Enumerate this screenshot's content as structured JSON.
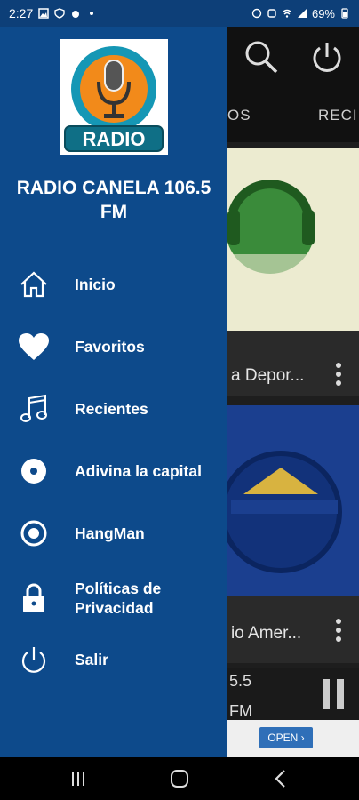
{
  "status_bar": {
    "time": "2:27",
    "battery": "69%"
  },
  "background": {
    "tabs": [
      "OS",
      "RECI"
    ],
    "stations": [
      {
        "title": "a Depor..."
      },
      {
        "title": "io Amer..."
      }
    ],
    "player": {
      "line1": "5.5",
      "line2": "FM"
    },
    "ad": {
      "open_label": "OPEN ›"
    }
  },
  "drawer": {
    "logo_text": "RADIO",
    "title": "RADIO CANELA 106.5 FM",
    "menu": [
      {
        "label": "Inicio",
        "icon": "home-icon"
      },
      {
        "label": "Favoritos",
        "icon": "heart-icon"
      },
      {
        "label": "Recientes",
        "icon": "music-note-icon"
      },
      {
        "label": "Adivina la capital",
        "icon": "disc-icon"
      },
      {
        "label": "HangMan",
        "icon": "target-icon"
      },
      {
        "label": "Políticas de Privacidad",
        "icon": "lock-icon"
      },
      {
        "label": "Salir",
        "icon": "power-icon"
      }
    ]
  },
  "colors": {
    "drawer": "#0d4a8b",
    "status_bar": "#0d3f78",
    "background": "#1e1e1e"
  }
}
